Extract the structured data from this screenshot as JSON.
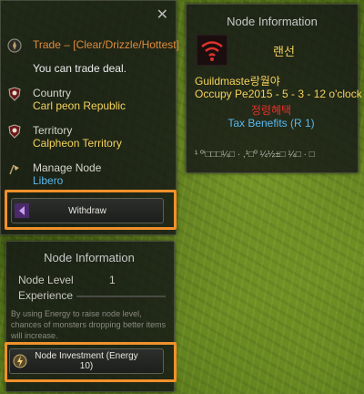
{
  "trade": {
    "title": "Trade – [Clear/Drizzle/Hottest]",
    "subtitle": "You can trade deal."
  },
  "country": {
    "label": "Country",
    "value": "Carl peon Republic"
  },
  "territory": {
    "label": "Territory",
    "value": "Calpheon Territory"
  },
  "manage_node": {
    "label": "Manage Node",
    "value": "Libero"
  },
  "withdraw_label": "Withdraw",
  "node_info_right": {
    "title": "Node Information",
    "name": "랜선",
    "guildmaster": "Guildmaste랑월야",
    "occupy": "Occupy Pe2015 - 5 - 3 - 12 o'clock",
    "benefits": "정령혜택",
    "tax": "Tax Benefits (R 1)",
    "garbled": "¹ ºⁱ□□□¼□ · ,¹□º ¼½±□ ¼□ · □"
  },
  "node_info_bottom": {
    "title": "Node Information",
    "level_label": "Node Level",
    "level_value": "1",
    "experience_label": "Experience",
    "experience_fraction": 0,
    "description": "By using Energy to raise node level, chances of monsters dropping better items will increase.",
    "investment_label": "Node Investment (Energy 10)"
  },
  "colors": {
    "highlight": "#f0912c",
    "trade_title": "#e08a3a",
    "value_yellow": "#f4d25a",
    "value_blue": "#59b8ee",
    "benefit_red": "#e0322c"
  }
}
